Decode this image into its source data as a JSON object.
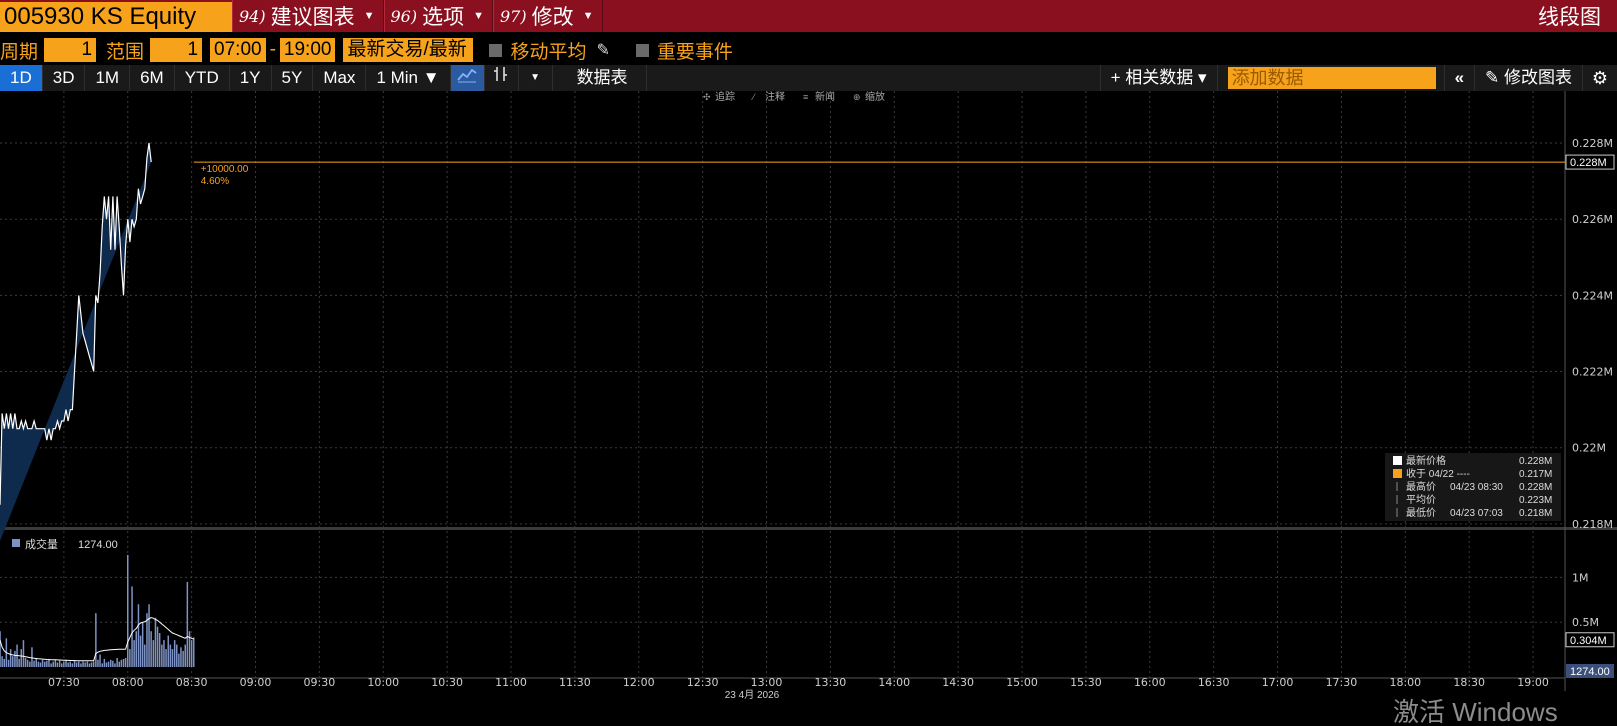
{
  "title": {
    "ticker": "005930 KS Equity",
    "menus": [
      {
        "num": "94)",
        "label": "建议图表"
      },
      {
        "num": "96)",
        "label": "选项"
      },
      {
        "num": "97)",
        "label": "修改"
      }
    ],
    "chart_type": "线段图"
  },
  "controls": {
    "period_label": "周期",
    "period_value": "1",
    "range_label": "范围",
    "range_value": "1",
    "start_time": "07:00",
    "dash": "-",
    "end_time": "19:00",
    "trade_mode": "最新交易/最新",
    "moving_avg": "移动平均",
    "events": "重要事件"
  },
  "toolbar": {
    "ranges": [
      "1D",
      "3D",
      "1M",
      "6M",
      "YTD",
      "1Y",
      "5Y",
      "Max"
    ],
    "interval": "1 Min ▼",
    "table_btn": "数据表",
    "related_btn": "+ 相关数据 ▾",
    "add_data_placeholder": "添加数据",
    "edit_chart_btn": "修改图表"
  },
  "chart_tools": [
    "追踪",
    "注释",
    "新闻",
    "缩放"
  ],
  "price_marker": {
    "change": "+10000.00",
    "pct": "4.60%",
    "last_tag": "0.228M"
  },
  "legend": [
    {
      "label": "最新价格",
      "date": "",
      "value": "0.228M",
      "color": "#ffffff"
    },
    {
      "label": "收于 04/22 ----",
      "date": "",
      "value": "0.217M",
      "color": "#f7a21b"
    },
    {
      "label": "最高价",
      "date": "04/23 08:30",
      "value": "0.228M",
      "color": ""
    },
    {
      "label": "平均价",
      "date": "",
      "value": "0.223M",
      "color": ""
    },
    {
      "label": "最低价",
      "date": "04/23 07:03",
      "value": "0.218M",
      "color": ""
    }
  ],
  "volume_legend": {
    "label": "成交量",
    "value": "1274.00",
    "avg_tag": "0.304M",
    "last_tag": "1274.00"
  },
  "date_label": "23 4月 2026",
  "watermark": "激活 Windows",
  "chart_data": {
    "type": "line",
    "x_unit": "time",
    "y_ticks": [
      "0.228M",
      "0.226M",
      "0.224M",
      "0.222M",
      "0.22M",
      "0.218M"
    ],
    "y_tick_values": [
      228000,
      226000,
      224000,
      222000,
      220000,
      218000
    ],
    "ylim": [
      217550,
      228500
    ],
    "x_ticks": [
      "07:30",
      "08:00",
      "08:30",
      "09:00",
      "09:30",
      "10:00",
      "10:30",
      "11:00",
      "11:30",
      "12:00",
      "12:30",
      "13:00",
      "13:30",
      "14:00",
      "14:30",
      "15:00",
      "15:30",
      "16:00",
      "16:30",
      "17:00",
      "17:30",
      "18:00",
      "18:30",
      "19:00"
    ],
    "x_tick_minutes": [
      450,
      480,
      510,
      540,
      570,
      600,
      630,
      660,
      690,
      720,
      750,
      780,
      810,
      840,
      870,
      900,
      930,
      960,
      990,
      1020,
      1050,
      1080,
      1110,
      1140
    ],
    "xlim": [
      420,
      1155
    ],
    "price": {
      "minutes": [
        420,
        421,
        422,
        423,
        424,
        425,
        426,
        427,
        428,
        429,
        430,
        431,
        432,
        433,
        434,
        435,
        436,
        437,
        438,
        439,
        440,
        441,
        442,
        443,
        444,
        445,
        446,
        447,
        448,
        449,
        450,
        451,
        452,
        453,
        454,
        455,
        456,
        457,
        458,
        459,
        460,
        461,
        462,
        463,
        464,
        465,
        466,
        467,
        468,
        469,
        470,
        471,
        472,
        473,
        474,
        475,
        476,
        477,
        478,
        479,
        480,
        481,
        482,
        483,
        484,
        485,
        486,
        487,
        488,
        489,
        490,
        491,
        492,
        493,
        494,
        495,
        496,
        497,
        498,
        499,
        500,
        501,
        502,
        503,
        504,
        505,
        506,
        507,
        508,
        509,
        510,
        511
      ],
      "values": [
        218500,
        220900,
        220500,
        220900,
        220500,
        220900,
        220500,
        220900,
        220500,
        220500,
        220700,
        220500,
        220700,
        220500,
        220500,
        220500,
        220700,
        220500,
        220500,
        220500,
        220500,
        220500,
        220200,
        220500,
        220200,
        220500,
        220500,
        220700,
        220500,
        220700,
        220700,
        221000,
        220700,
        221000,
        221000,
        222000,
        223000,
        224000,
        223500,
        223000,
        222800,
        222600,
        222400,
        222200,
        222000,
        224000,
        223800,
        224600,
        225800,
        226600,
        226000,
        226600,
        225200,
        226600,
        225200,
        226600,
        225800,
        224800,
        224000,
        225300,
        226000,
        225400,
        226000,
        225800,
        226000,
        226800,
        226400,
        226600,
        226800,
        227600,
        228000,
        227500
      ]
    },
    "volume": {
      "yticks": [
        "1M",
        "0.5M"
      ],
      "ytick_values": [
        1000000,
        500000
      ],
      "ylim": [
        0,
        1250000
      ],
      "minutes": [
        420,
        421,
        422,
        423,
        424,
        425,
        426,
        427,
        428,
        429,
        430,
        431,
        432,
        433,
        434,
        435,
        436,
        437,
        438,
        439,
        440,
        441,
        442,
        443,
        444,
        445,
        446,
        447,
        448,
        449,
        450,
        451,
        452,
        453,
        454,
        455,
        456,
        457,
        458,
        459,
        460,
        461,
        462,
        463,
        464,
        465,
        466,
        467,
        468,
        469,
        470,
        471,
        472,
        473,
        474,
        475,
        476,
        477,
        478,
        479,
        480,
        481,
        482,
        483,
        484,
        485,
        486,
        487,
        488,
        489,
        490,
        491,
        492,
        493,
        494,
        495,
        496,
        497,
        498,
        499,
        500,
        501,
        502,
        503,
        504,
        505,
        506,
        507,
        508,
        509,
        510,
        511
      ],
      "values": [
        400000,
        120000,
        90000,
        320000,
        80000,
        200000,
        120000,
        180000,
        250000,
        90000,
        200000,
        300000,
        100000,
        80000,
        60000,
        220000,
        70000,
        90000,
        60000,
        50000,
        80000,
        60000,
        70000,
        90000,
        40000,
        60000,
        80000,
        50000,
        70000,
        40000,
        60000,
        80000,
        50000,
        60000,
        40000,
        70000,
        50000,
        60000,
        40000,
        60000,
        50000,
        60000,
        40000,
        50000,
        60000,
        600000,
        80000,
        140000,
        40000,
        90000,
        50000,
        60000,
        80000,
        70000,
        40000,
        100000,
        60000,
        80000,
        90000,
        100000,
        1250000,
        200000,
        900000,
        300000,
        400000,
        700000,
        350000,
        500000,
        250000,
        600000,
        700000,
        400000,
        300000,
        550000,
        450000,
        380000,
        250000,
        300000,
        200000,
        350000,
        250000,
        200000,
        300000,
        250000,
        150000,
        220000,
        180000,
        250000,
        950000,
        400000,
        300000,
        330000
      ],
      "avg": [
        300000,
        220000,
        180000,
        160000,
        150000,
        140000,
        135000,
        130000,
        128000,
        125000,
        123000,
        120000,
        115000,
        110000,
        105000,
        102000,
        98000,
        95000,
        92000,
        90000,
        88000,
        86000,
        84000,
        83000,
        82000,
        81000,
        80000,
        79000,
        78000,
        77000,
        76000,
        75000,
        74000,
        73000,
        72000,
        71000,
        70000,
        70000,
        70000,
        70000,
        70000,
        70000,
        70000,
        70000,
        70000,
        150000,
        165000,
        175000,
        180000,
        185000,
        188000,
        190000,
        192000,
        194000,
        195000,
        196000,
        197000,
        198000,
        199000,
        200000,
        280000,
        330000,
        380000,
        410000,
        430000,
        470000,
        490000,
        500000,
        505000,
        520000,
        540000,
        550000,
        545000,
        530000,
        520000,
        500000,
        480000,
        460000,
        440000,
        420000,
        400000,
        380000,
        370000,
        360000,
        350000,
        340000,
        330000,
        320000,
        340000,
        330000,
        320000,
        310000
      ]
    }
  }
}
